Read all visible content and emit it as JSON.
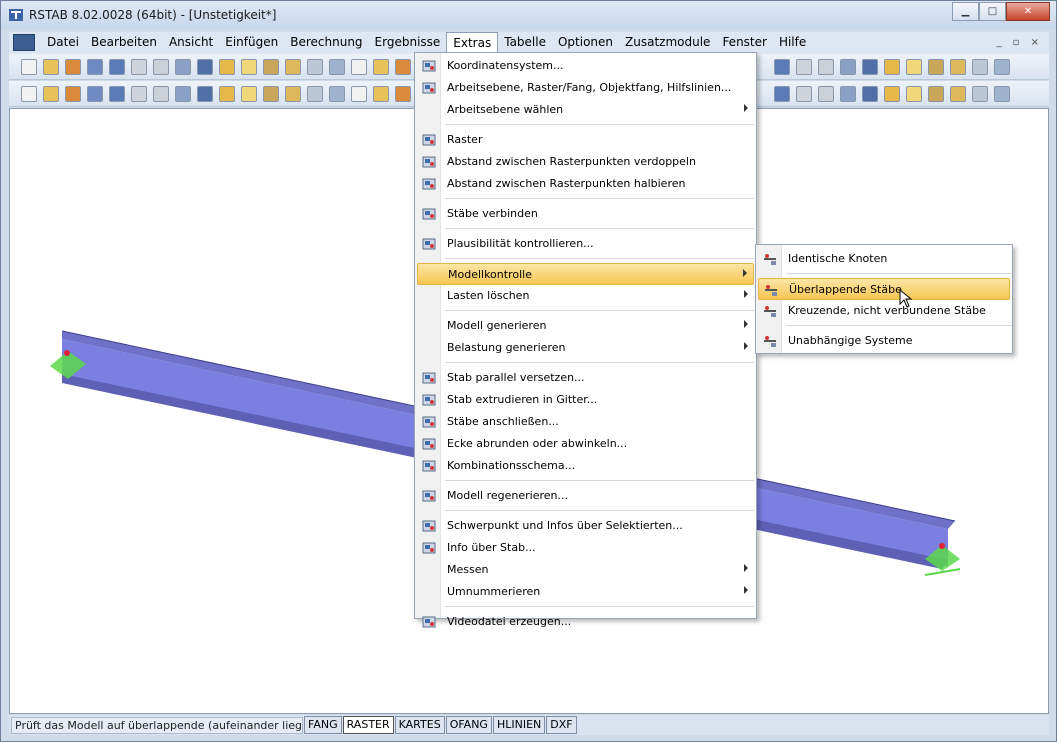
{
  "window": {
    "title": "RSTAB 8.02.0028 (64bit) - [Unstetigkeit*]"
  },
  "menubar": {
    "items": [
      "Datei",
      "Bearbeiten",
      "Ansicht",
      "Einfügen",
      "Berechnung",
      "Ergebnisse",
      "Extras",
      "Tabelle",
      "Optionen",
      "Zusatzmodule",
      "Fenster",
      "Hilfe"
    ],
    "active": "Extras"
  },
  "extras_menu": {
    "items": [
      {
        "label": "Koordinatensystem...",
        "icon": "coordinate-system-icon"
      },
      {
        "label": "Arbeitsebene, Raster/Fang, Objektfang, Hilfslinien...",
        "icon": "workplane-grid-icon"
      },
      {
        "label": "Arbeitsebene wählen",
        "icon": "",
        "submenu": true
      },
      {
        "label": "Raster",
        "icon": "grid-icon"
      },
      {
        "label": "Abstand zwischen Rasterpunkten verdoppeln",
        "icon": "grid-double-icon"
      },
      {
        "label": "Abstand zwischen Rasterpunkten halbieren",
        "icon": "grid-half-icon"
      },
      {
        "label": "Stäbe verbinden",
        "icon": "connect-members-icon"
      },
      {
        "label": "Plausibilität kontrollieren...",
        "icon": "plausibility-check-icon"
      },
      {
        "label": "Modellkontrolle",
        "icon": "",
        "submenu": true
      },
      {
        "label": "Lasten löschen",
        "icon": "",
        "submenu": true
      },
      {
        "label": "Modell generieren",
        "icon": "",
        "submenu": true
      },
      {
        "label": "Belastung generieren",
        "icon": "",
        "submenu": true
      },
      {
        "label": "Stab parallel versetzen...",
        "icon": "offset-member-icon"
      },
      {
        "label": "Stab extrudieren in Gitter...",
        "icon": "extrude-member-icon"
      },
      {
        "label": "Stäbe anschließen...",
        "icon": "connect-members-icon"
      },
      {
        "label": "Ecke abrunden oder abwinkeln...",
        "icon": "round-corner-icon"
      },
      {
        "label": "Kombinationsschema...",
        "icon": "combination-scheme-icon"
      },
      {
        "label": "Modell regenerieren...",
        "icon": "regenerate-model-icon"
      },
      {
        "label": "Schwerpunkt und Infos über Selektierten...",
        "icon": "centroid-icon"
      },
      {
        "label": "Info über Stab...",
        "icon": "info-icon"
      },
      {
        "label": "Messen",
        "icon": "",
        "submenu": true
      },
      {
        "label": "Umnummerieren",
        "icon": "",
        "submenu": true
      },
      {
        "label": "Videodatei erzeugen...",
        "icon": "video-file-icon"
      }
    ]
  },
  "submenu": {
    "items": [
      {
        "label": "Identische Knoten",
        "icon": "identical-nodes-icon"
      },
      {
        "label": "Überlappende Stäbe",
        "icon": "overlapping-members-icon"
      },
      {
        "label": "Kreuzende, nicht verbundene Stäbe",
        "icon": "crossing-members-icon"
      },
      {
        "label": "Unabhängige Systeme",
        "icon": "independent-systems-icon"
      }
    ],
    "highlighted": "Überlappende Stäbe"
  },
  "statusbar": {
    "message": "Prüft das Modell auf überlappende (aufeinander liegende) Stäbe",
    "buttons": [
      "FANG",
      "RASTER",
      "KARTES",
      "OFANG",
      "HLINIEN",
      "DXF"
    ],
    "pressed": "RASTER"
  },
  "colors": {
    "beam": "#7b7fe0",
    "support": "#5bd84a",
    "menu_highlight": "#f7c652"
  }
}
